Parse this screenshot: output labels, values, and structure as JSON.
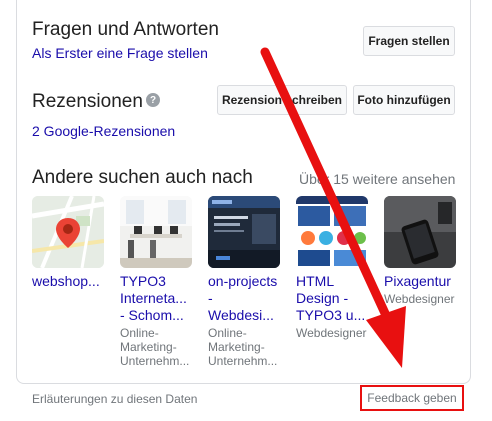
{
  "qa": {
    "title": "Fragen und Antworten",
    "first_question_link": "Als Erster eine Frage stellen",
    "ask_button": "Fragen stellen"
  },
  "reviews": {
    "title": "Rezensionen",
    "help_icon": "?",
    "write_review_button": "Rezension schreiben",
    "add_photo_button": "Foto hinzufügen",
    "count_link": "2 Google-Rezensionen"
  },
  "also_searched": {
    "title": "Andere suchen auch nach",
    "more_link": "Über 15 weitere ansehen",
    "items": [
      {
        "name": "webshop...",
        "subtitle": "",
        "icon": "map-thumbnail"
      },
      {
        "name": "TYPO3 Interneta... - Schom...",
        "subtitle": "Online-Marketing-Unternehm...",
        "icon": "office-photo"
      },
      {
        "name": "on-projects - Webdesi...",
        "subtitle": "Online-Marketing-Unternehm...",
        "icon": "dark-web-screenshot"
      },
      {
        "name": "HTML Design - TYPO3 u...",
        "subtitle": "Webdesigner",
        "icon": "web-collage"
      },
      {
        "name": "Pixagentur",
        "subtitle": "Webdesigner",
        "icon": "phone-desk-photo"
      }
    ]
  },
  "footer": {
    "data_info_link": "Erläuterungen zu diesen Daten",
    "feedback_link": "Feedback geben"
  },
  "colors": {
    "link": "#1a0dab",
    "annotation_red": "#e81010",
    "border": "#dadce0"
  }
}
